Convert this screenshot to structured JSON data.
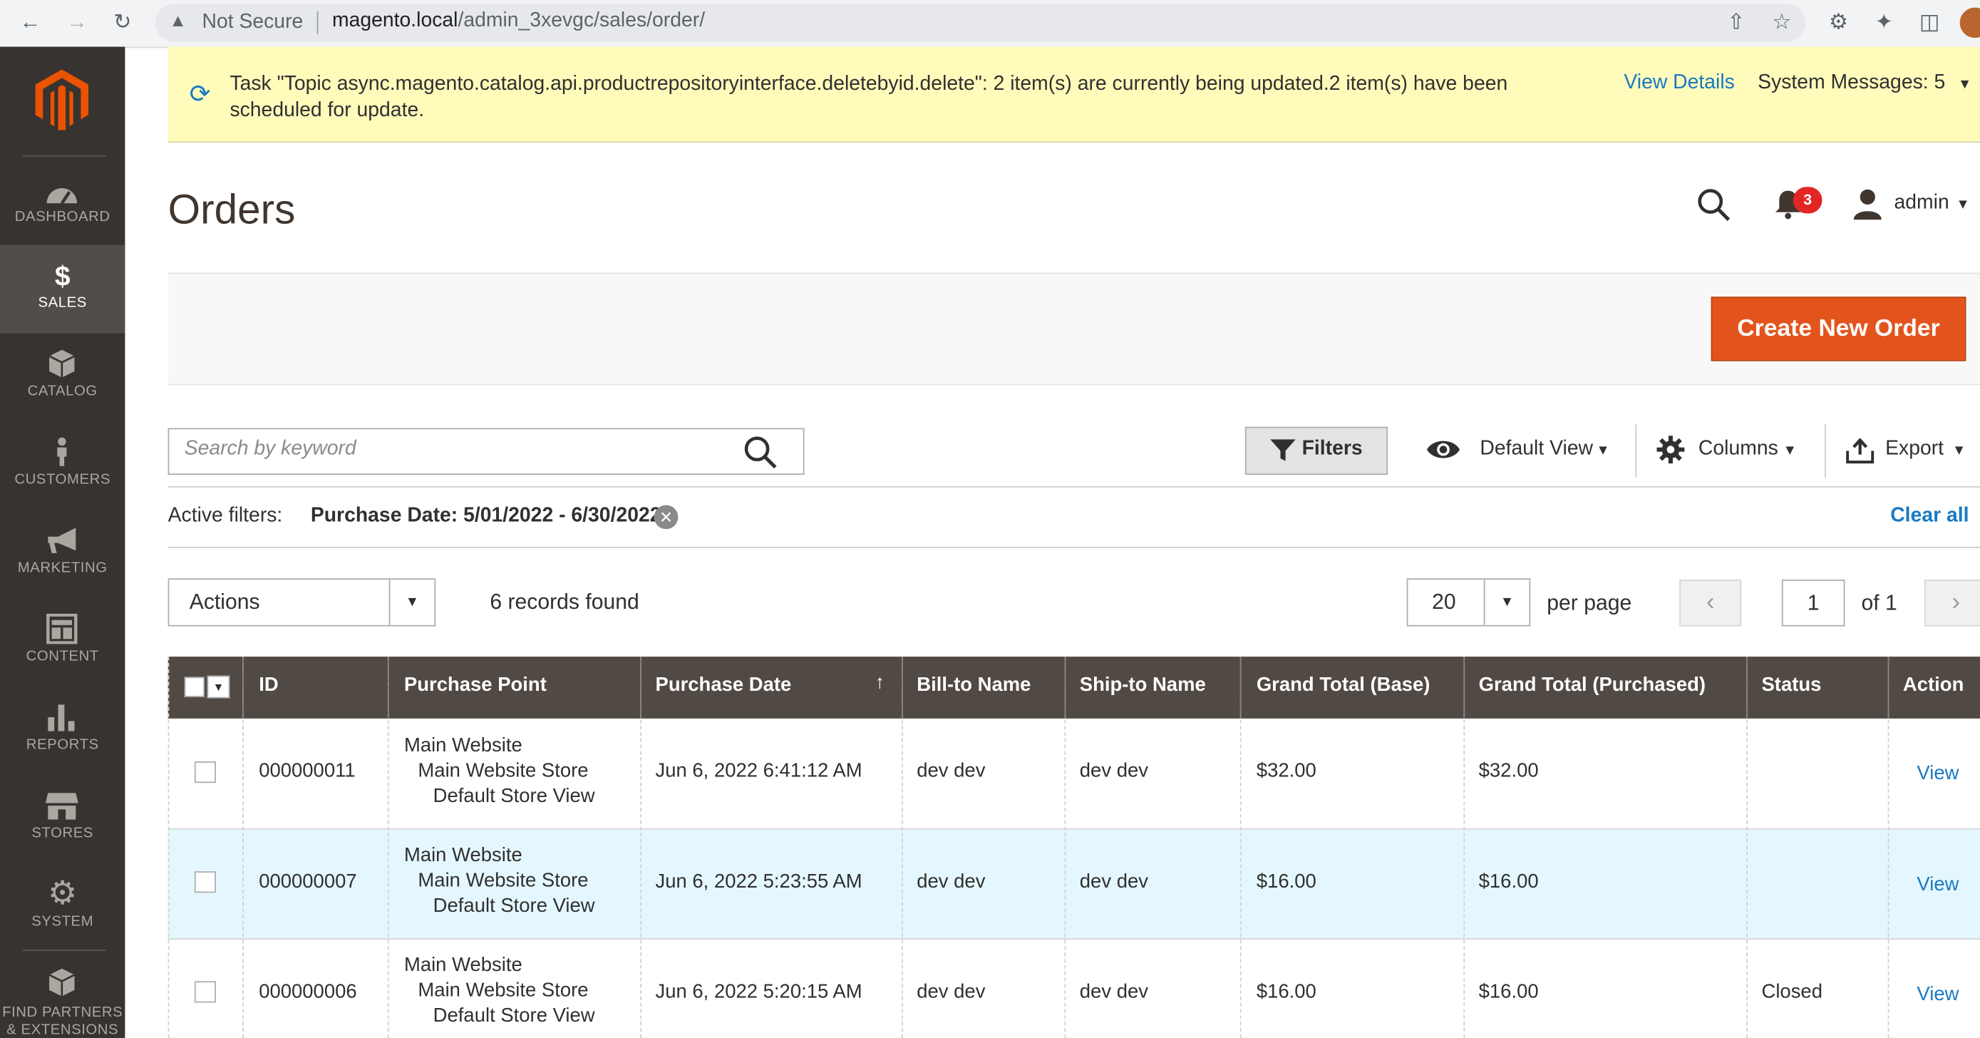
{
  "browser": {
    "security_label": "Not Secure",
    "url_host": "magento.local",
    "url_path": "/admin_3xevgc/sales/order/"
  },
  "sidebar": {
    "items": [
      {
        "label": "DASHBOARD",
        "icon": "dashboard-icon"
      },
      {
        "label": "SALES",
        "icon": "dollar-icon",
        "active": true
      },
      {
        "label": "CATALOG",
        "icon": "cube-icon"
      },
      {
        "label": "CUSTOMERS",
        "icon": "person-icon"
      },
      {
        "label": "MARKETING",
        "icon": "megaphone-icon"
      },
      {
        "label": "CONTENT",
        "icon": "layout-icon"
      },
      {
        "label": "REPORTS",
        "icon": "bar-chart-icon"
      },
      {
        "label": "STORES",
        "icon": "storefront-icon"
      },
      {
        "label": "SYSTEM",
        "icon": "gear-icon"
      },
      {
        "label": "FIND PARTNERS\n& EXTENSIONS",
        "icon": "boxes-icon"
      }
    ]
  },
  "system_message": {
    "text": "Task \"Topic async.magento.catalog.api.productrepositoryinterface.deletebyid.delete\": 2 item(s) are currently being updated.2 item(s) have been scheduled for update.",
    "view_details": "View Details",
    "count_label": "System Messages: 5"
  },
  "header": {
    "title": "Orders",
    "notification_count": "3",
    "user_name": "admin"
  },
  "action_bar": {
    "create_order_label": "Create New Order"
  },
  "toolbar": {
    "search_placeholder": "Search by keyword",
    "filters_label": "Filters",
    "view_label": "Default View",
    "columns_label": "Columns",
    "export_label": "Export"
  },
  "active_filters": {
    "label": "Active filters:",
    "value": "Purchase Date: 5/01/2022 - 6/30/2022",
    "clear_all": "Clear all"
  },
  "grid_controls": {
    "actions_label": "Actions",
    "records_found": "6 records found",
    "per_page_value": "20",
    "per_page_label": "per page",
    "current_page": "1",
    "total_pages_label": "of 1"
  },
  "grid": {
    "columns": [
      "ID",
      "Purchase Point",
      "Purchase Date",
      "Bill-to Name",
      "Ship-to Name",
      "Grand Total (Base)",
      "Grand Total (Purchased)",
      "Status",
      "Action"
    ],
    "rows": [
      {
        "id": "000000011",
        "purchase_point": [
          "Main Website",
          "Main Website Store",
          "Default Store View"
        ],
        "purchase_date": "Jun 6, 2022 6:41:12 AM",
        "bill_to": "dev dev",
        "ship_to": "dev dev",
        "total_base": "$32.00",
        "total_purchased": "$32.00",
        "status": "",
        "action": "View"
      },
      {
        "id": "000000007",
        "purchase_point": [
          "Main Website",
          "Main Website Store",
          "Default Store View"
        ],
        "purchase_date": "Jun 6, 2022 5:23:55 AM",
        "bill_to": "dev dev",
        "ship_to": "dev dev",
        "total_base": "$16.00",
        "total_purchased": "$16.00",
        "status": "",
        "action": "View"
      },
      {
        "id": "000000006",
        "purchase_point": [
          "Main Website",
          "Main Website Store",
          "Default Store View"
        ],
        "purchase_date": "Jun 6, 2022 5:20:15 AM",
        "bill_to": "dev dev",
        "ship_to": "dev dev",
        "total_base": "$16.00",
        "total_purchased": "$16.00",
        "status": "Closed",
        "action": "View"
      }
    ]
  },
  "colors": {
    "sidebar_bg": "#373330",
    "sidebar_active": "#524d49",
    "accent_orange": "#e3541d",
    "link_blue": "#1979c3",
    "message_bg": "#fffbbb",
    "grid_header": "#514943",
    "row_highlight": "#e5f7fe"
  }
}
